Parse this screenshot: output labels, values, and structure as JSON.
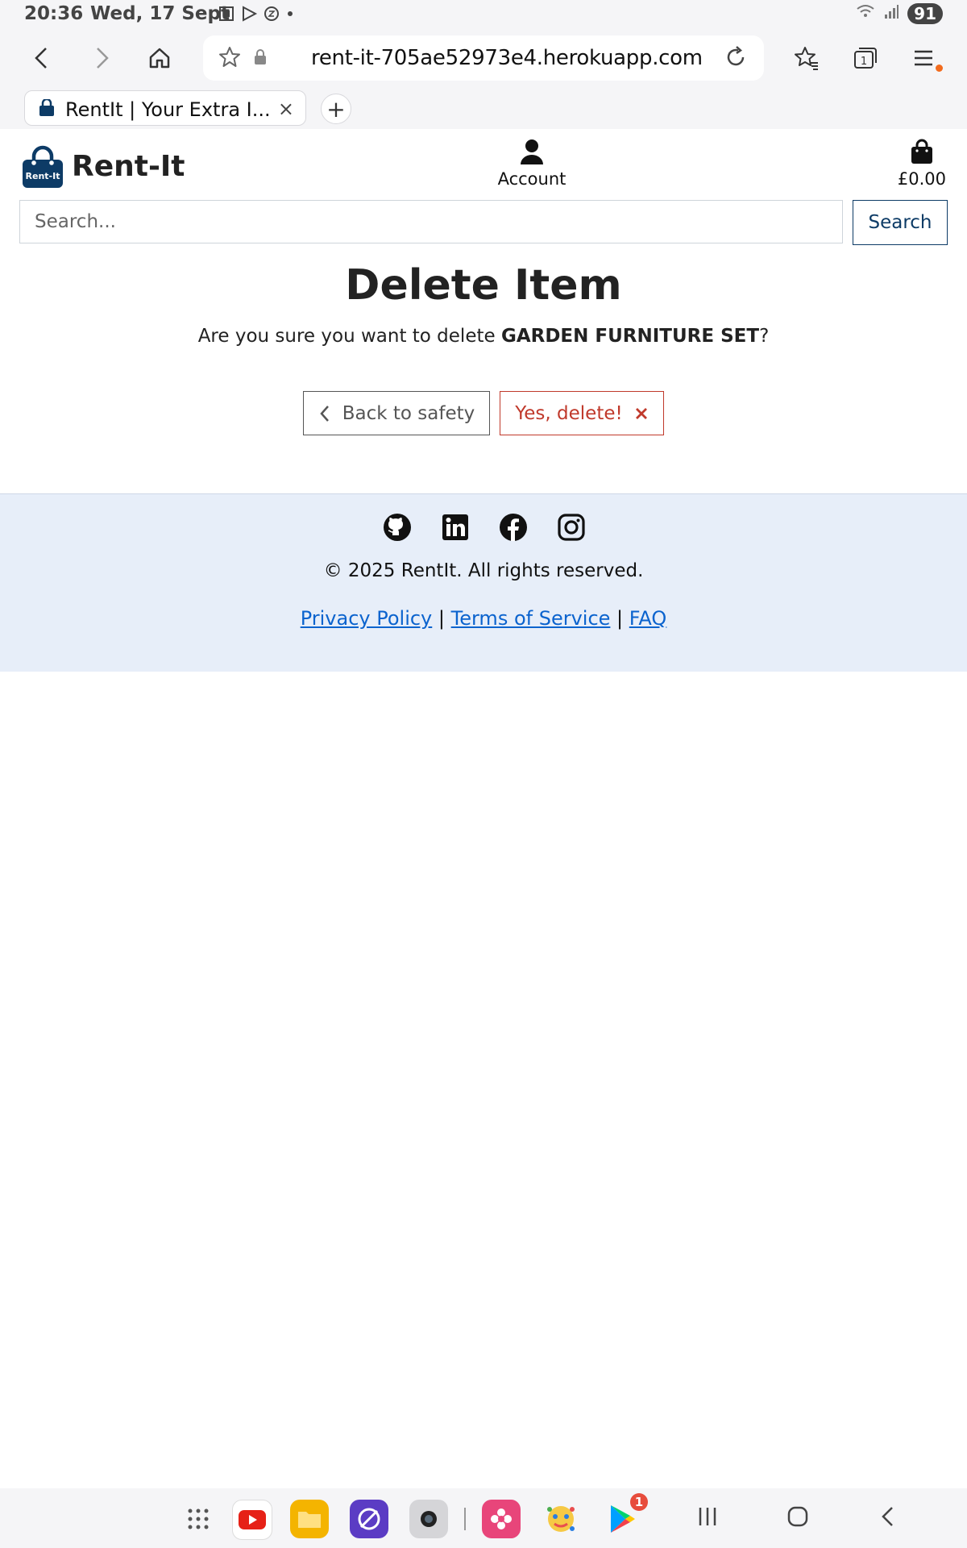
{
  "status_bar": {
    "time": "20:36",
    "date": "Wed, 17 Sept",
    "battery": "91",
    "icons": [
      "screenshot-icon",
      "play-icon",
      "bedtime-icon",
      "dot-icon",
      "wifi-icon",
      "signal-icon"
    ]
  },
  "browser": {
    "url": "rent-it-705ae52973e4.herokuapp.com",
    "tab_title": "RentIt | Your Extra I...",
    "tab_close": "×",
    "new_tab": "+",
    "tab_count": "1"
  },
  "header": {
    "brand": "Rent-It",
    "logo_text": "Rent-It",
    "account_label": "Account",
    "basket_total": "£0.00"
  },
  "search": {
    "placeholder": "Search...",
    "button_label": "Search"
  },
  "main": {
    "title": "Delete Item",
    "question_prefix": "Are you sure you want to delete ",
    "item_name": "GARDEN FURNITURE SET",
    "question_suffix": "?",
    "back_label": "Back to safety",
    "delete_label": "Yes, delete!"
  },
  "footer": {
    "copyright": "© 2025 RentIt. All rights reserved.",
    "links": [
      "Privacy Policy",
      "Terms of Service",
      "FAQ"
    ],
    "separator": "|",
    "socials": [
      "github-icon",
      "linkedin-icon",
      "facebook-icon",
      "instagram-icon"
    ]
  },
  "dock": {
    "play_store_badge": "1"
  },
  "colors": {
    "brand_blue": "#0d3b66",
    "danger": "#c0392b",
    "footer_bg": "#e7eef9",
    "link": "#0b63ce"
  }
}
